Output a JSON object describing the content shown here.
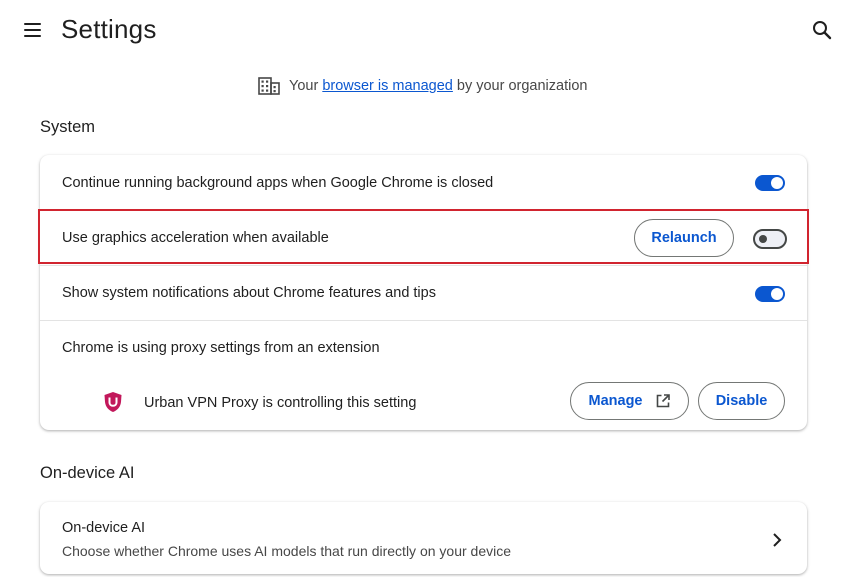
{
  "header": {
    "title": "Settings"
  },
  "managed_notice": {
    "prefix": "Your",
    "link": "browser is managed",
    "suffix": "by your organization"
  },
  "system": {
    "section_title": "System",
    "rows": [
      {
        "label": "Continue running background apps when Google Chrome is closed",
        "enabled": true
      },
      {
        "label": "Use graphics acceleration when available",
        "enabled": false,
        "button": "Relaunch"
      },
      {
        "label": "Show system notifications about Chrome features and tips",
        "enabled": true
      },
      {
        "label": "Chrome is using proxy settings from an extension"
      }
    ],
    "extension": {
      "label": "Urban VPN Proxy is controlling this setting",
      "manage_label": "Manage",
      "disable_label": "Disable"
    }
  },
  "ai": {
    "section_title": "On-device AI",
    "row_title": "On-device AI",
    "row_description": "Choose whether Chrome uses AI models that run directly on your device"
  },
  "colors": {
    "accent": "#0b57d0",
    "highlight": "#d1242f",
    "extension_icon": "#c2185b"
  }
}
